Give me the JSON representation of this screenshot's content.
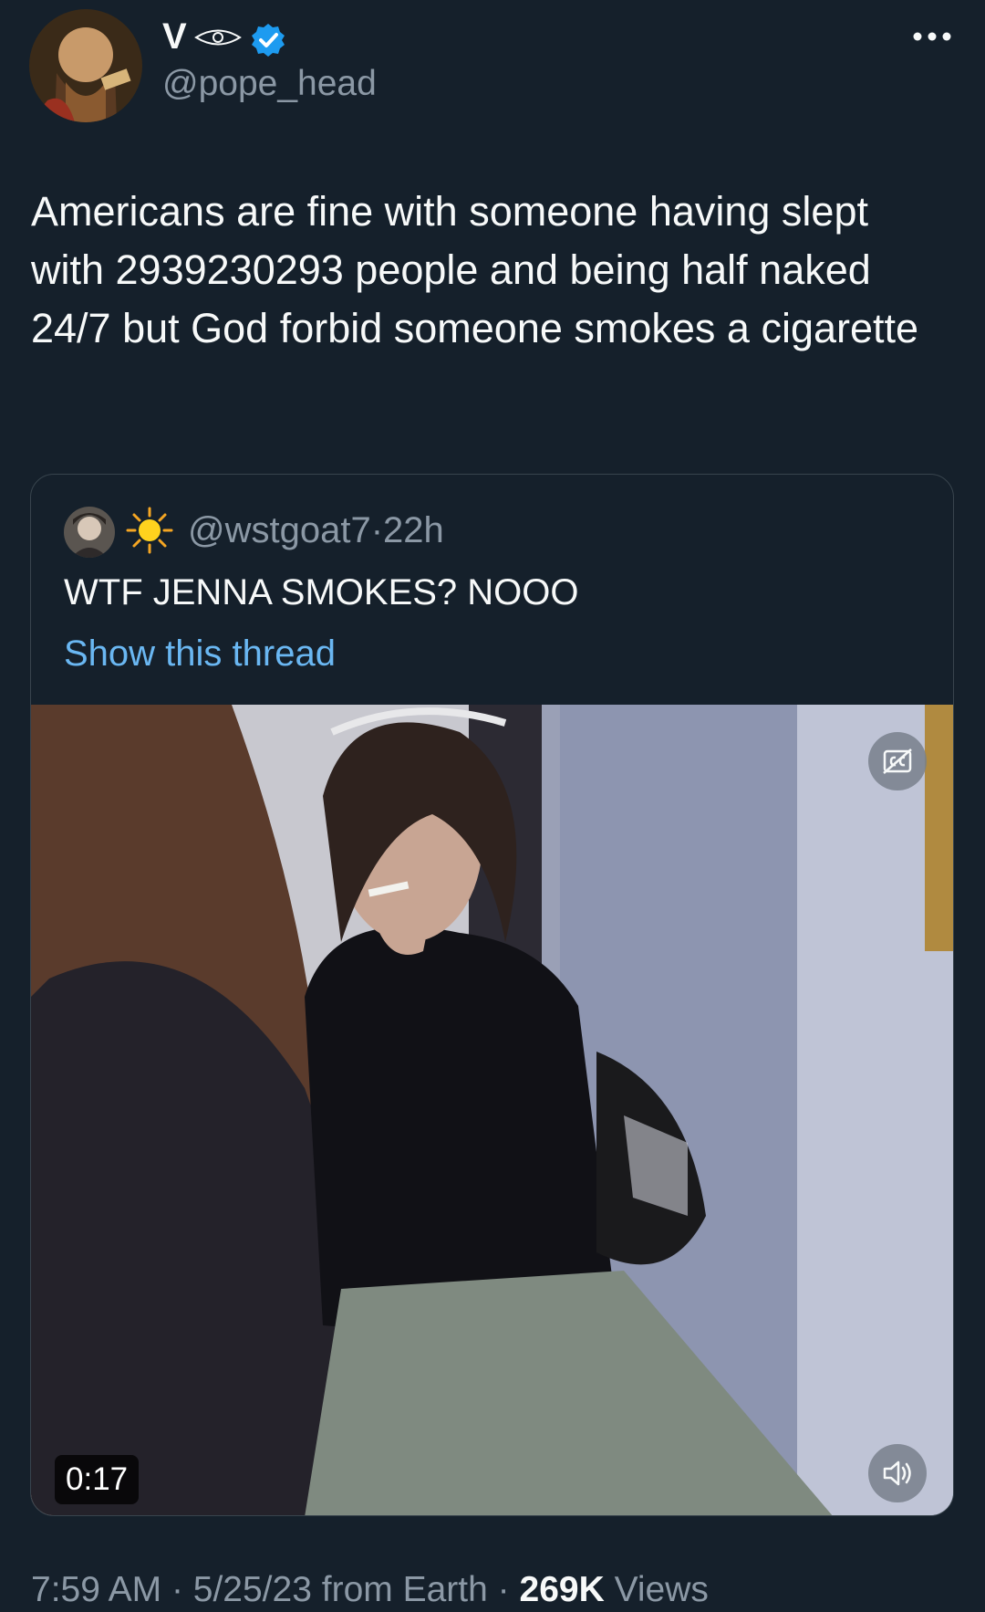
{
  "author": {
    "display_name": "V",
    "handle": "@pope_head",
    "icons": [
      "eye-icon",
      "verified-icon"
    ]
  },
  "menu": {
    "icon": "more-icon"
  },
  "tweet": {
    "text": "Americans are fine with someone having slept with 2939230293 people and being half naked 24/7 but God forbid someone smokes a cigarette"
  },
  "quoted": {
    "handle": "@wstgoat7",
    "separator": "·",
    "time": "22h",
    "text": "WTF JENNA SMOKES? NOOO",
    "thread_link": "Show this thread",
    "video": {
      "duration": "0:17",
      "icons": [
        "captions-icon",
        "volume-icon"
      ]
    }
  },
  "meta": {
    "time": "7:59 AM",
    "sep1": "·",
    "date": "5/25/23",
    "source": "from Earth",
    "sep2": "·",
    "views_count": "269K",
    "views_label": "Views"
  },
  "colors": {
    "background": "#15202b",
    "text_primary": "#f7f9f9",
    "text_secondary": "#8b98a5",
    "link": "#6ab7f2",
    "verified": "#1d9bf0",
    "border": "#38444d"
  }
}
